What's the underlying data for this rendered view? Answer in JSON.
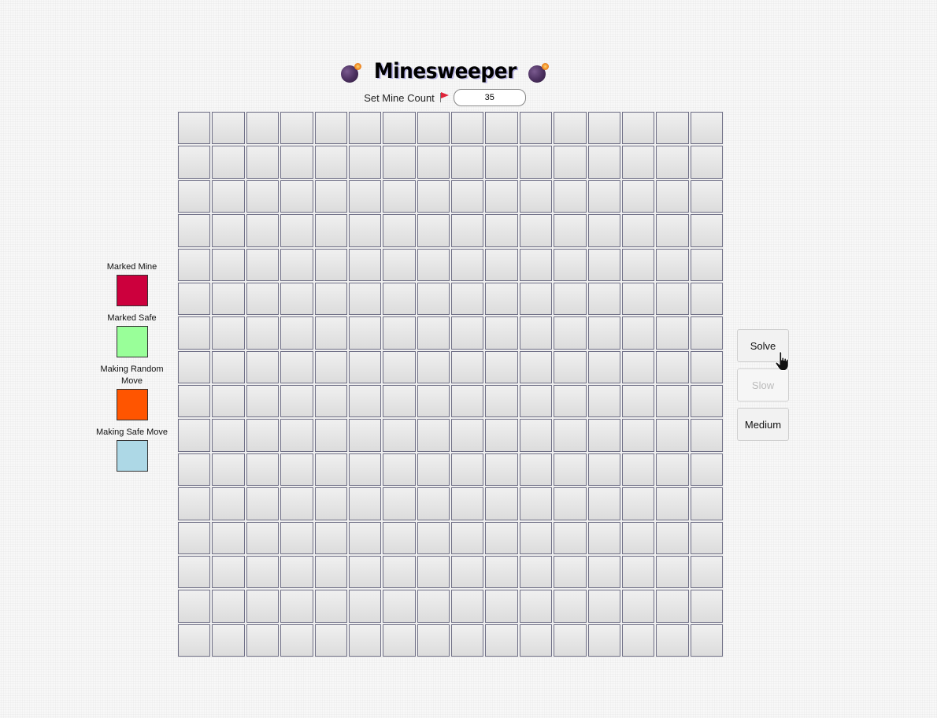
{
  "header": {
    "title": "Minesweeper",
    "mine_count_label": "Set Mine Count",
    "mine_count_value": "35"
  },
  "legend": {
    "items": [
      {
        "label": "Marked Mine",
        "color": "#cc003d"
      },
      {
        "label": "Marked Safe",
        "color": "#99ff99"
      },
      {
        "label": "Making Random Move",
        "color": "#ff5500"
      },
      {
        "label": "Making Safe Move",
        "color": "#add8e6"
      }
    ]
  },
  "board": {
    "rows": 16,
    "cols": 16,
    "state": "all-unrevealed"
  },
  "controls": {
    "solve_label": "Solve",
    "slow_label": "Slow",
    "medium_label": "Medium",
    "slow_disabled": true
  },
  "icons": {
    "title_left": "bomb-icon",
    "title_right": "bomb-icon",
    "mine_count": "flag-icon",
    "cursor": "hand-pointer-icon"
  }
}
